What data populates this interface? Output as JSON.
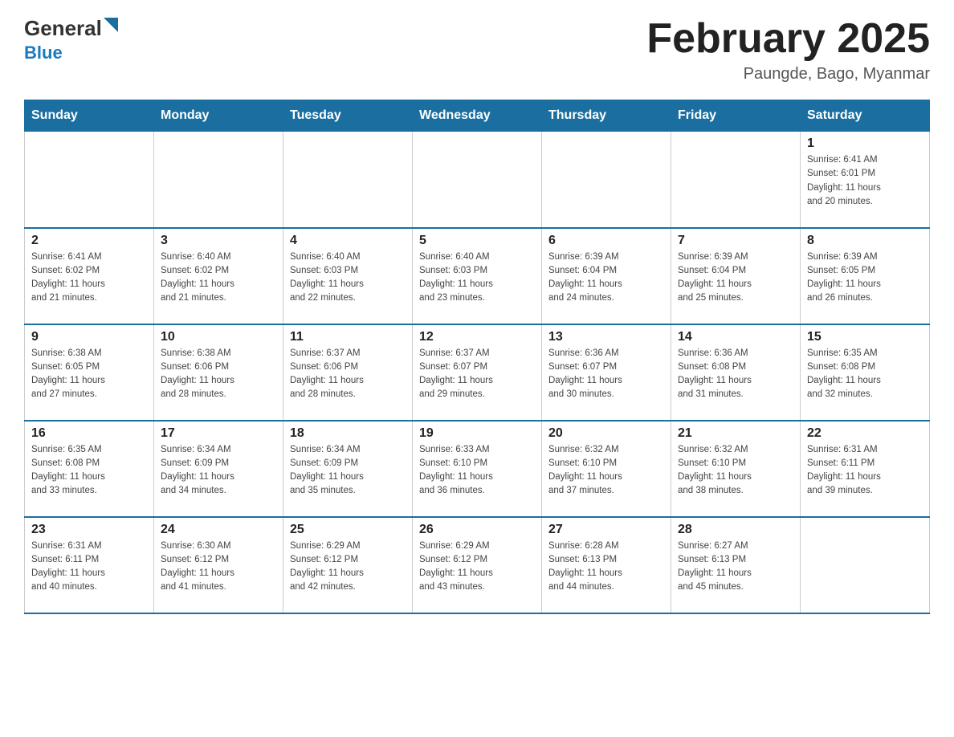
{
  "header": {
    "logo_general": "General",
    "logo_blue": "Blue",
    "month_title": "February 2025",
    "location": "Paungde, Bago, Myanmar"
  },
  "days_of_week": [
    "Sunday",
    "Monday",
    "Tuesday",
    "Wednesday",
    "Thursday",
    "Friday",
    "Saturday"
  ],
  "weeks": [
    {
      "days": [
        {
          "date": "",
          "info": ""
        },
        {
          "date": "",
          "info": ""
        },
        {
          "date": "",
          "info": ""
        },
        {
          "date": "",
          "info": ""
        },
        {
          "date": "",
          "info": ""
        },
        {
          "date": "",
          "info": ""
        },
        {
          "date": "1",
          "info": "Sunrise: 6:41 AM\nSunset: 6:01 PM\nDaylight: 11 hours\nand 20 minutes."
        }
      ]
    },
    {
      "days": [
        {
          "date": "2",
          "info": "Sunrise: 6:41 AM\nSunset: 6:02 PM\nDaylight: 11 hours\nand 21 minutes."
        },
        {
          "date": "3",
          "info": "Sunrise: 6:40 AM\nSunset: 6:02 PM\nDaylight: 11 hours\nand 21 minutes."
        },
        {
          "date": "4",
          "info": "Sunrise: 6:40 AM\nSunset: 6:03 PM\nDaylight: 11 hours\nand 22 minutes."
        },
        {
          "date": "5",
          "info": "Sunrise: 6:40 AM\nSunset: 6:03 PM\nDaylight: 11 hours\nand 23 minutes."
        },
        {
          "date": "6",
          "info": "Sunrise: 6:39 AM\nSunset: 6:04 PM\nDaylight: 11 hours\nand 24 minutes."
        },
        {
          "date": "7",
          "info": "Sunrise: 6:39 AM\nSunset: 6:04 PM\nDaylight: 11 hours\nand 25 minutes."
        },
        {
          "date": "8",
          "info": "Sunrise: 6:39 AM\nSunset: 6:05 PM\nDaylight: 11 hours\nand 26 minutes."
        }
      ]
    },
    {
      "days": [
        {
          "date": "9",
          "info": "Sunrise: 6:38 AM\nSunset: 6:05 PM\nDaylight: 11 hours\nand 27 minutes."
        },
        {
          "date": "10",
          "info": "Sunrise: 6:38 AM\nSunset: 6:06 PM\nDaylight: 11 hours\nand 28 minutes."
        },
        {
          "date": "11",
          "info": "Sunrise: 6:37 AM\nSunset: 6:06 PM\nDaylight: 11 hours\nand 28 minutes."
        },
        {
          "date": "12",
          "info": "Sunrise: 6:37 AM\nSunset: 6:07 PM\nDaylight: 11 hours\nand 29 minutes."
        },
        {
          "date": "13",
          "info": "Sunrise: 6:36 AM\nSunset: 6:07 PM\nDaylight: 11 hours\nand 30 minutes."
        },
        {
          "date": "14",
          "info": "Sunrise: 6:36 AM\nSunset: 6:08 PM\nDaylight: 11 hours\nand 31 minutes."
        },
        {
          "date": "15",
          "info": "Sunrise: 6:35 AM\nSunset: 6:08 PM\nDaylight: 11 hours\nand 32 minutes."
        }
      ]
    },
    {
      "days": [
        {
          "date": "16",
          "info": "Sunrise: 6:35 AM\nSunset: 6:08 PM\nDaylight: 11 hours\nand 33 minutes."
        },
        {
          "date": "17",
          "info": "Sunrise: 6:34 AM\nSunset: 6:09 PM\nDaylight: 11 hours\nand 34 minutes."
        },
        {
          "date": "18",
          "info": "Sunrise: 6:34 AM\nSunset: 6:09 PM\nDaylight: 11 hours\nand 35 minutes."
        },
        {
          "date": "19",
          "info": "Sunrise: 6:33 AM\nSunset: 6:10 PM\nDaylight: 11 hours\nand 36 minutes."
        },
        {
          "date": "20",
          "info": "Sunrise: 6:32 AM\nSunset: 6:10 PM\nDaylight: 11 hours\nand 37 minutes."
        },
        {
          "date": "21",
          "info": "Sunrise: 6:32 AM\nSunset: 6:10 PM\nDaylight: 11 hours\nand 38 minutes."
        },
        {
          "date": "22",
          "info": "Sunrise: 6:31 AM\nSunset: 6:11 PM\nDaylight: 11 hours\nand 39 minutes."
        }
      ]
    },
    {
      "days": [
        {
          "date": "23",
          "info": "Sunrise: 6:31 AM\nSunset: 6:11 PM\nDaylight: 11 hours\nand 40 minutes."
        },
        {
          "date": "24",
          "info": "Sunrise: 6:30 AM\nSunset: 6:12 PM\nDaylight: 11 hours\nand 41 minutes."
        },
        {
          "date": "25",
          "info": "Sunrise: 6:29 AM\nSunset: 6:12 PM\nDaylight: 11 hours\nand 42 minutes."
        },
        {
          "date": "26",
          "info": "Sunrise: 6:29 AM\nSunset: 6:12 PM\nDaylight: 11 hours\nand 43 minutes."
        },
        {
          "date": "27",
          "info": "Sunrise: 6:28 AM\nSunset: 6:13 PM\nDaylight: 11 hours\nand 44 minutes."
        },
        {
          "date": "28",
          "info": "Sunrise: 6:27 AM\nSunset: 6:13 PM\nDaylight: 11 hours\nand 45 minutes."
        },
        {
          "date": "",
          "info": ""
        }
      ]
    }
  ]
}
